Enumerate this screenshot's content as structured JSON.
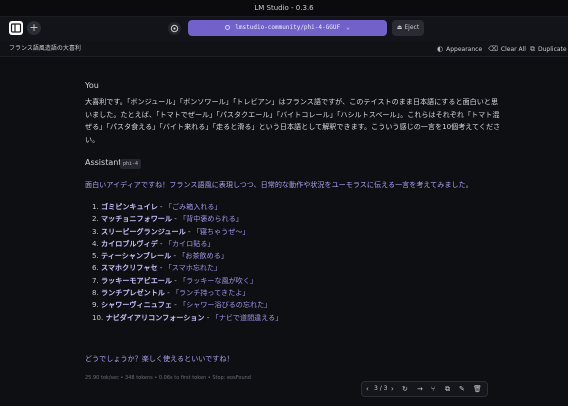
{
  "window": {
    "title": "LM Studio - 0.3.6"
  },
  "toolbar": {
    "model_name": "lmstudio-community/phi-4-GGUF",
    "eject_label": "Eject",
    "new_chat_icon": "plus-icon",
    "settings_icon": "gear-icon"
  },
  "chat": {
    "title": "フランス語風造語の大喜利",
    "actions": {
      "appearance": "Appearance",
      "clear_all": "Clear All",
      "duplicate": "Duplicate"
    }
  },
  "user": {
    "speaker": "You",
    "text": "大喜利です。「ボンジュール」「ボンソワール」「トレビアン」はフランス語ですが、このテイストのまま日本語にすると面白いと思いました。たとえば、「トマトでぜール」「パスタクエール」「バイトコレール」「ハシルトスベール」。これらはそれぞれ「トマト混ぜる」「パスタ食える」「バイト来れる」「走ると滑る」という日本語として解釈できます。こういう感じの一言を10個考えてください。"
  },
  "assistant": {
    "speaker": "Assistant",
    "model_badge": "phi-4",
    "intro": "面白いアイディアですね！フランス語風に表現しつつ、日常的な動作や状況をユーモラスに伝える一言を考えてみました。",
    "items": [
      {
        "num": "1.",
        "name": "ゴミピンキュイレ",
        "desc": "「ごみ箱入れる」"
      },
      {
        "num": "2.",
        "name": "マッチョニフォワール",
        "desc": "「背中褒められる」"
      },
      {
        "num": "3.",
        "name": "スリーピーグランジュール",
        "desc": "「寝ちゃうぜ〜」"
      },
      {
        "num": "4.",
        "name": "カイロブルヴィデ",
        "desc": "「カイロ貼る」"
      },
      {
        "num": "5.",
        "name": "ティーシャンブレール",
        "desc": "「お茶飲める」"
      },
      {
        "num": "6.",
        "name": "スマホクリフャセ",
        "desc": "「スマホ忘れた」"
      },
      {
        "num": "7.",
        "name": "ラッキーモアビエール",
        "desc": "「ラッキーな風が吹く」"
      },
      {
        "num": "8.",
        "name": "ランチプレゼントル",
        "desc": "「ランチ持ってきたよ」"
      },
      {
        "num": "9.",
        "name": "シャワーヴィニュフェ",
        "desc": "「シャワー浴びるの忘れた」"
      },
      {
        "num": "10.",
        "name": "ナビダイアリコンフォーション",
        "desc": "「ナビで道間違える」"
      }
    ],
    "outro": "どうでしょうか？楽しく使えるといいですね！",
    "stats": "25.90 tok/sec  •  348 tokens  •  0.06s to first token  •  Stop: eosFound"
  },
  "pager": {
    "text": "3 / 3"
  },
  "colors": {
    "accent": "#7161c9",
    "assistant_text": "#a9a2f2",
    "background": "#0e0f13"
  }
}
